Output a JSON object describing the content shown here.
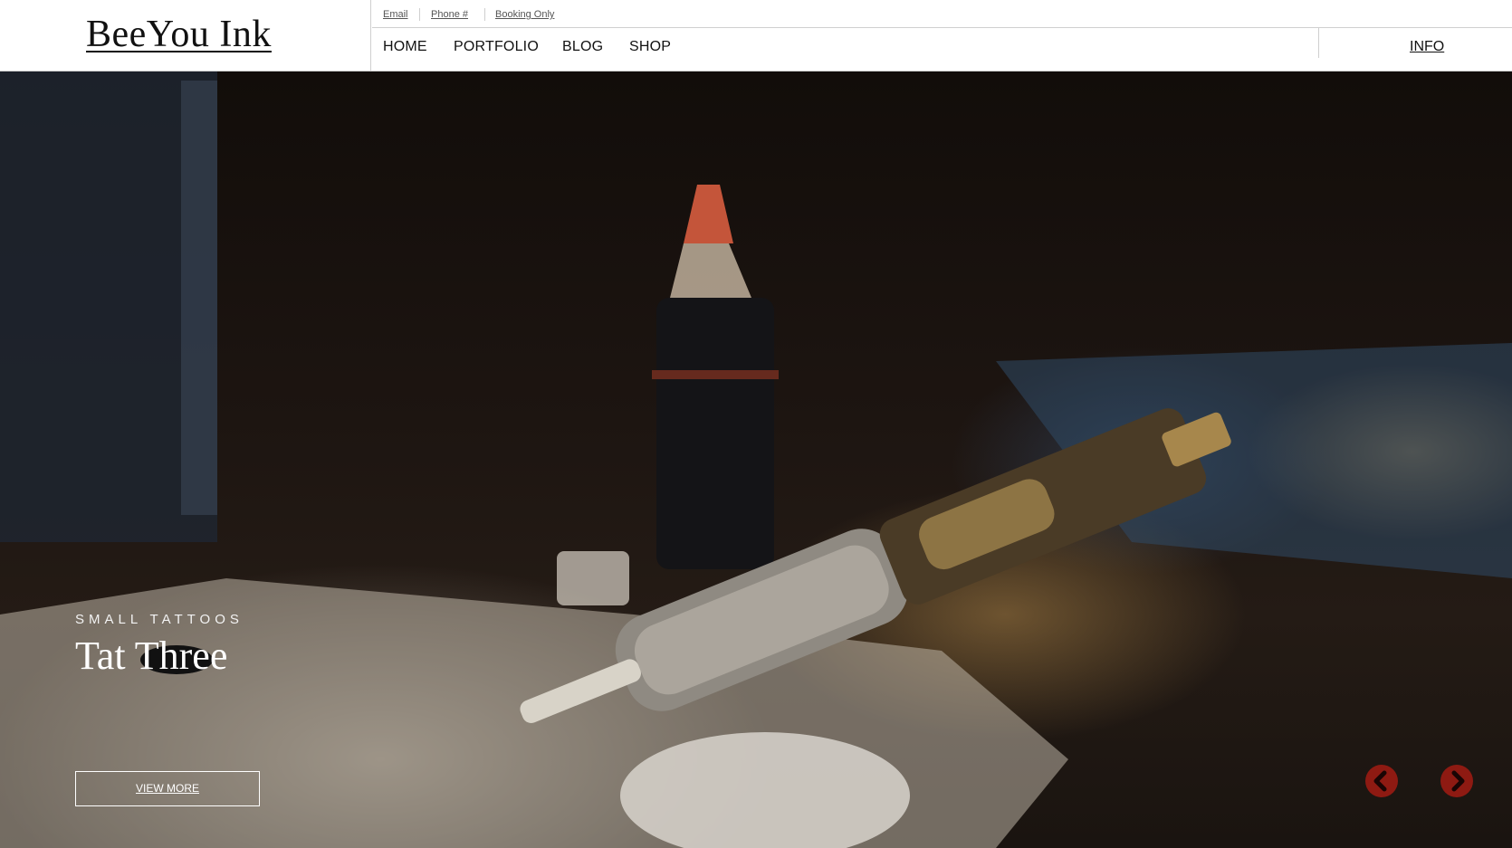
{
  "site": {
    "logo": "BeeYou Ink"
  },
  "top_links": {
    "email": "Email",
    "phone": "Phone #",
    "booking": "Booking Only"
  },
  "nav": {
    "home": "HOME",
    "portfolio": "PORTFOLIO",
    "blog": "BLOG",
    "shop": "SHOP",
    "info": "INFO"
  },
  "slide": {
    "eyebrow": "SMALL TATTOOS",
    "title": "Tat Three",
    "button": "VIEW MORE"
  },
  "slider_controls": {
    "prev_icon": "chevron-left-icon",
    "next_icon": "chevron-right-icon",
    "accent": "#8e1a12"
  },
  "colors": {
    "header_bg": "#ffffff",
    "border": "#cfcfcf",
    "text": "#111111"
  }
}
